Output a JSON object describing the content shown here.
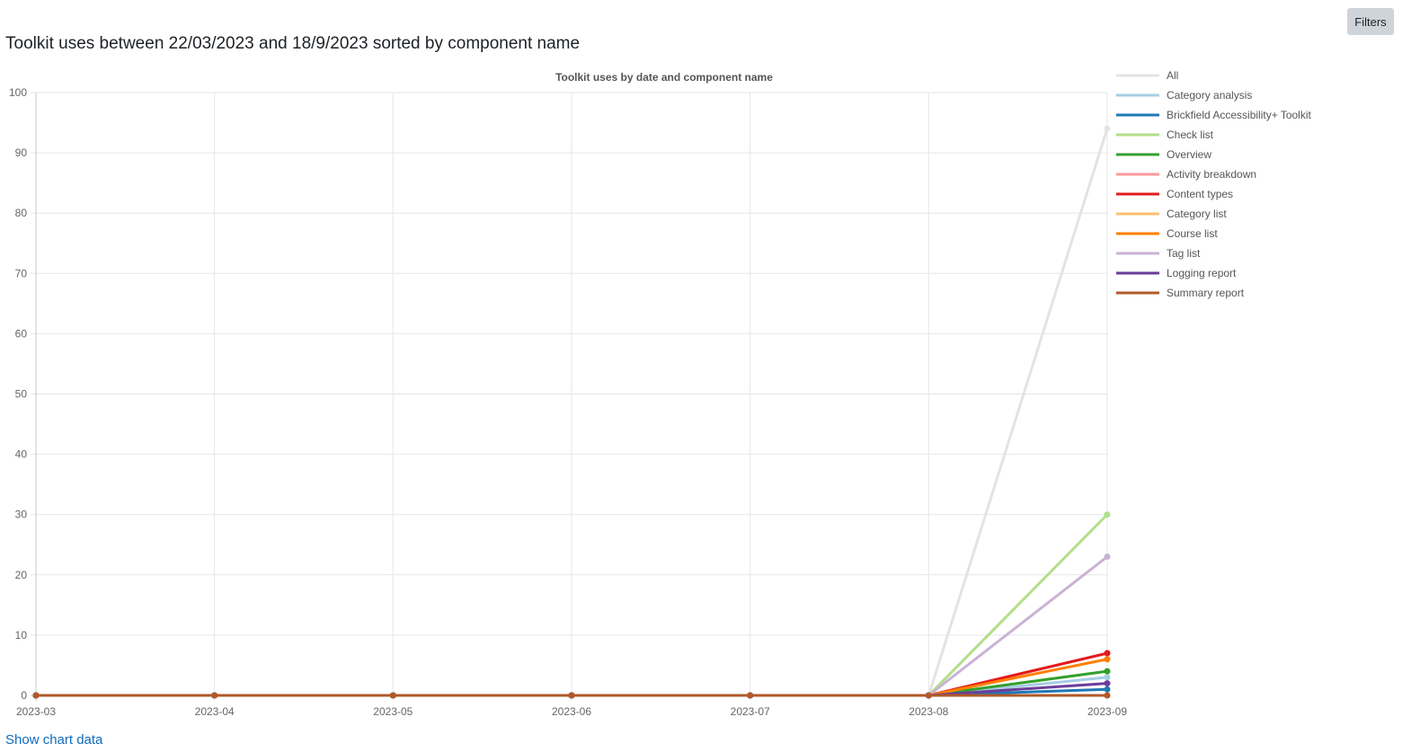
{
  "page": {
    "heading": "Toolkit uses between 22/03/2023 and 18/9/2023 sorted by component name",
    "filters_label": "Filters",
    "show_chart_data_label": "Show chart data"
  },
  "chart_data": {
    "type": "line",
    "title": "Toolkit uses by date and component name",
    "xlabel": "",
    "ylabel": "",
    "categories": [
      "2023-03",
      "2023-04",
      "2023-05",
      "2023-06",
      "2023-07",
      "2023-08",
      "2023-09"
    ],
    "ylim": [
      0,
      100
    ],
    "yticks": [
      0,
      10,
      20,
      30,
      40,
      50,
      60,
      70,
      80,
      90,
      100
    ],
    "grid": true,
    "legend_position": "right",
    "series": [
      {
        "name": "All",
        "color": "#e3e3e3",
        "values": [
          0,
          0,
          0,
          0,
          0,
          0,
          94
        ]
      },
      {
        "name": "Category analysis",
        "color": "#a6cee3",
        "values": [
          0,
          0,
          0,
          0,
          0,
          0,
          3
        ]
      },
      {
        "name": "Brickfield Accessibility+ Toolkit",
        "color": "#1f78b4",
        "values": [
          0,
          0,
          0,
          0,
          0,
          0,
          1
        ]
      },
      {
        "name": "Check list",
        "color": "#b2df8a",
        "values": [
          0,
          0,
          0,
          0,
          0,
          0,
          30
        ]
      },
      {
        "name": "Overview",
        "color": "#33a02c",
        "values": [
          0,
          0,
          0,
          0,
          0,
          0,
          4
        ]
      },
      {
        "name": "Activity breakdown",
        "color": "#fb9a99",
        "values": [
          0,
          0,
          0,
          0,
          0,
          0,
          7
        ]
      },
      {
        "name": "Content types",
        "color": "#e31a1c",
        "values": [
          0,
          0,
          0,
          0,
          0,
          0,
          7
        ]
      },
      {
        "name": "Category list",
        "color": "#fdbf6f",
        "values": [
          0,
          0,
          0,
          0,
          0,
          0,
          0
        ]
      },
      {
        "name": "Course list",
        "color": "#ff7f00",
        "values": [
          0,
          0,
          0,
          0,
          0,
          0,
          6
        ]
      },
      {
        "name": "Tag list",
        "color": "#cab2d6",
        "values": [
          0,
          0,
          0,
          0,
          0,
          0,
          23
        ]
      },
      {
        "name": "Logging report",
        "color": "#6a3d9a",
        "values": [
          0,
          0,
          0,
          0,
          0,
          0,
          2
        ]
      },
      {
        "name": "Summary report",
        "color": "#b15928",
        "values": [
          0,
          0,
          0,
          0,
          0,
          0,
          0
        ]
      }
    ]
  }
}
